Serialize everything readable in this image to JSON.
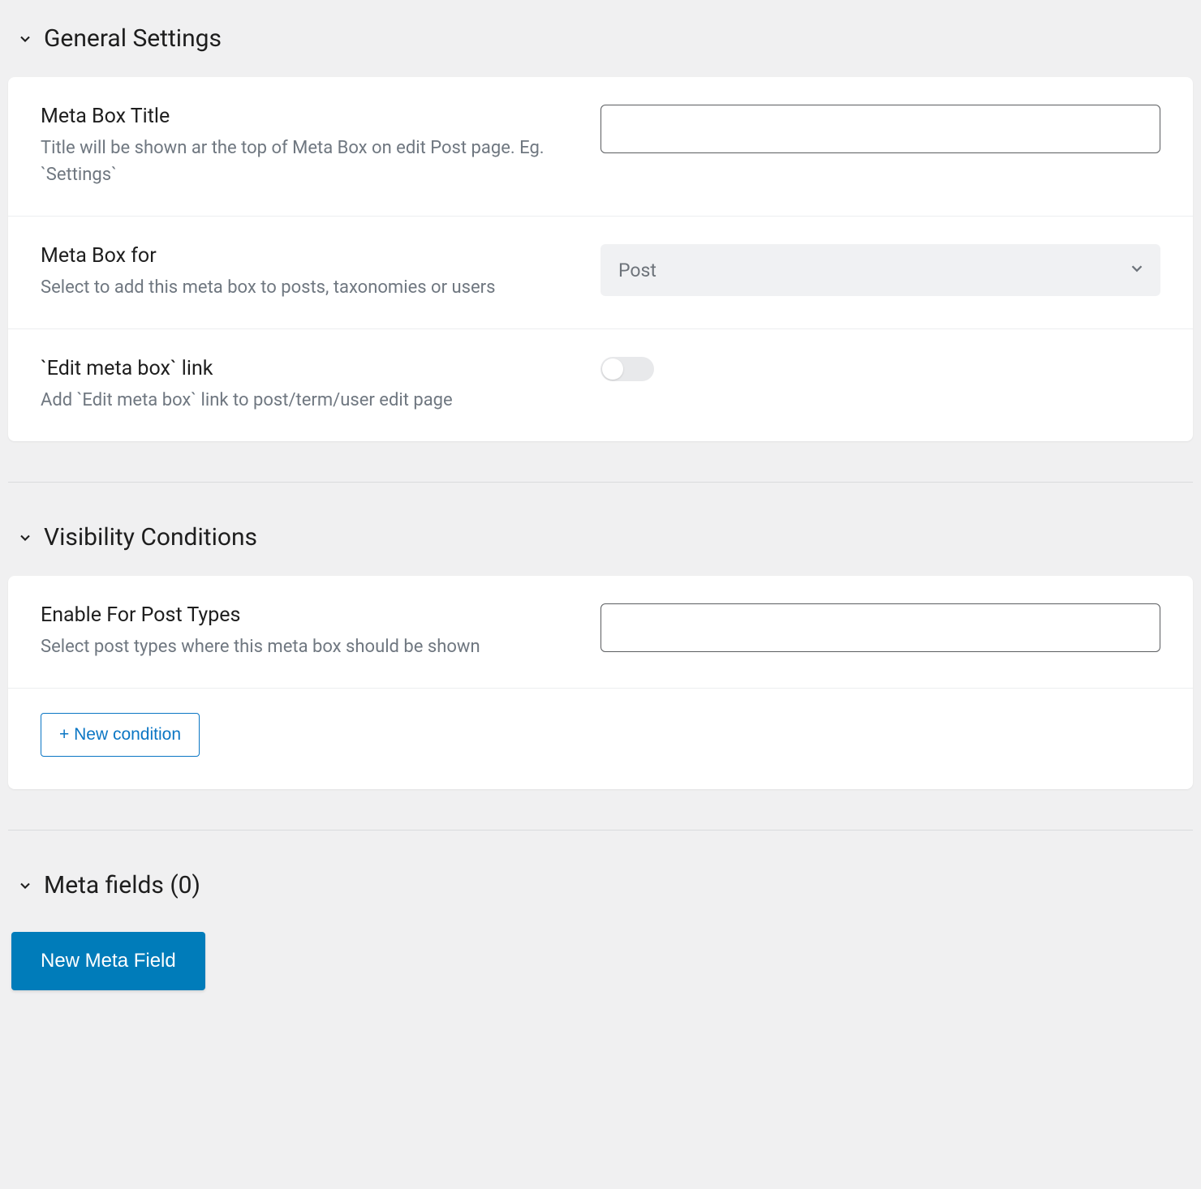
{
  "sections": {
    "general": {
      "title": "General Settings",
      "rows": {
        "title": {
          "label": "Meta Box Title",
          "desc": "Title will be shown ar the top of Meta Box on edit Post page. Eg. `Settings`",
          "value": ""
        },
        "for": {
          "label": "Meta Box for",
          "desc": "Select to add this meta box to posts, taxonomies or users",
          "selected": "Post"
        },
        "editlink": {
          "label": "`Edit meta box` link",
          "desc": "Add `Edit meta box` link to post/term/user edit page",
          "on": false
        }
      }
    },
    "visibility": {
      "title": "Visibility Conditions",
      "rows": {
        "posttypes": {
          "label": "Enable For Post Types",
          "desc": "Select post types where this meta box should be shown",
          "value": ""
        }
      },
      "new_condition_label": "+ New condition"
    },
    "metafields": {
      "title": "Meta fields (0)",
      "new_button": "New Meta Field"
    }
  }
}
